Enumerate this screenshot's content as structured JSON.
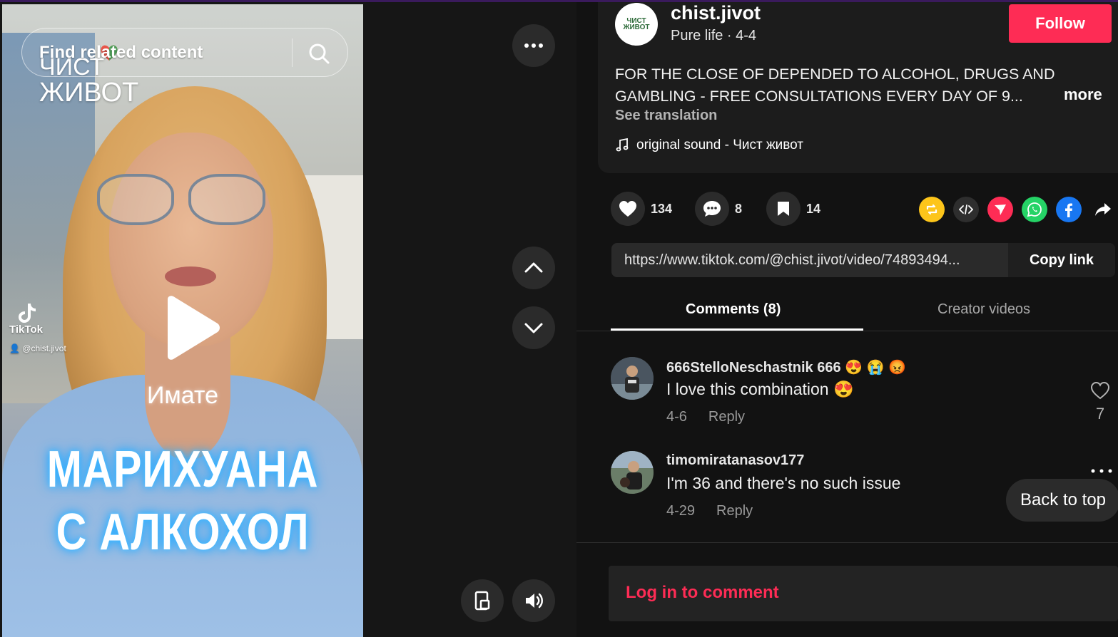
{
  "video": {
    "search_placeholder": "Find related content",
    "logo_line1": "ЧИСТ",
    "logo_line2": "ЖИВОТ",
    "watermark_brand": "TikTok",
    "watermark_handle": "@chist.jivot",
    "caption_small": "Имате",
    "caption_line1": "МАРИХУАНА",
    "caption_line2": "С АЛКОХОЛ"
  },
  "post": {
    "avatar_text": "ЧИСТ ЖИВОТ",
    "username": "chist.jivot",
    "subline": "Pure life · 4-4",
    "follow_label": "Follow",
    "description": "FOR THE CLOSE OF DEPENDED TO ALCOHOL, DRUGS AND GAMBLING - FREE CONSULTATIONS EVERY DAY OF 9...",
    "more_label": "more",
    "translate_label": "See translation",
    "sound": "original sound - Чист живот"
  },
  "actions": {
    "likes": "134",
    "comments": "8",
    "saves": "14"
  },
  "share": {
    "link": "https://www.tiktok.com/@chist.jivot/video/74893494...",
    "copy_label": "Copy link"
  },
  "tabs": {
    "comments": "Comments (8)",
    "creator": "Creator videos"
  },
  "comments": [
    {
      "name": "666StelloNeschastnik 666",
      "name_emoji": "😍 😭 😡",
      "text": "I love this combination 😍",
      "date": "4-6",
      "reply": "Reply",
      "likes": "7"
    },
    {
      "name": "timomiratanasov177",
      "text": "I'm 36 and there's no such issue",
      "date": "4-29",
      "reply": "Reply"
    }
  ],
  "back_to_top": "Back to top",
  "login_prompt": "Log in to comment",
  "colors": {
    "accent": "#fe2c55",
    "background": "#121212",
    "card": "#1c1c1c"
  }
}
